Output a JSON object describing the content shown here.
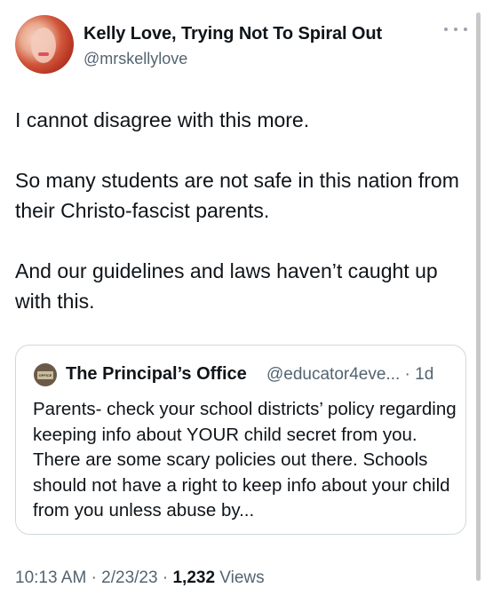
{
  "tweet": {
    "author_name": "Kelly Love, Trying Not To Spiral Out",
    "author_handle": "@mrskellylove",
    "paragraphs": [
      "I cannot disagree with this more.",
      "So many students are not safe in this nation from their Christo-fascist parents.",
      "And our guidelines and laws haven’t caught up with this."
    ],
    "time": "10:13 AM",
    "date": "2/23/23",
    "separator": "·",
    "views_count": "1,232",
    "views_label": "Views"
  },
  "quote": {
    "author_name": "The Principal’s Office",
    "author_handle": "@educator4eve...",
    "separator": "·",
    "age": "1d",
    "avatar_plate_text": "OFFICE",
    "text": "Parents- check your school districts’ policy regarding keeping info about YOUR child secret from you. There are some scary policies out there. Schools should not have a right to keep info about your child from you unless abuse by..."
  },
  "icons": {
    "more": "more-icon"
  }
}
